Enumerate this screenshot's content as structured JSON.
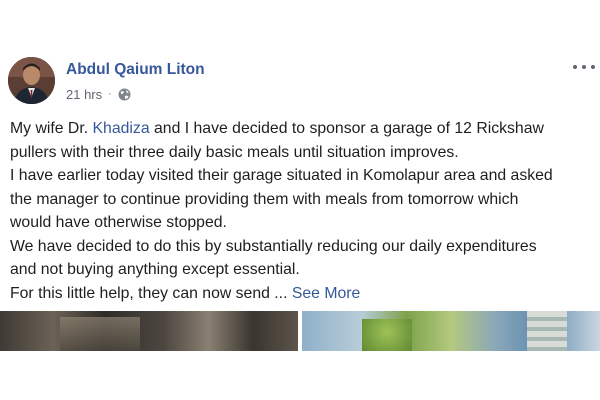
{
  "post": {
    "author": "Abdul Qaium Liton",
    "time": "21 hrs",
    "meta_separator": "·",
    "privacy_icon": "globe-icon",
    "more_icon": "more-options-icon",
    "body": {
      "l1_a": "My wife Dr. ",
      "l1_mention": "Khadiza",
      "l1_b": " and I have decided to sponsor a garage of 12 Rickshaw",
      "l2": "pullers with their three daily basic meals until situation improves.",
      "l3": "I have earlier today visited their garage situated in Komolapur area and asked",
      "l4": "the manager to continue providing them with meals from tomorrow which",
      "l5": "would have otherwise stopped.",
      "l6": "We have decided to do this by substantially reducing our daily expenditures",
      "l7": "and not buying anything except essential.",
      "l8": "For this little help, they can now send ... ",
      "see_more": "See More"
    }
  },
  "colors": {
    "link": "#365899",
    "text": "#1c1e21",
    "meta": "#616770"
  }
}
